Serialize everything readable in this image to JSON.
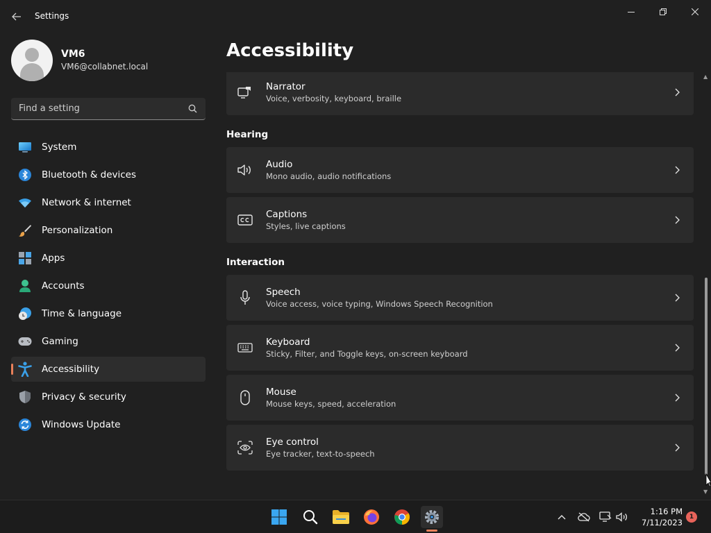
{
  "window": {
    "app_title": "Settings",
    "back_icon": "arrow-left-icon",
    "controls": [
      "minimize-icon",
      "restore-icon",
      "close-icon"
    ]
  },
  "profile": {
    "name": "VM6",
    "email": "VM6@collabnet.local"
  },
  "search": {
    "placeholder": "Find a setting",
    "value": ""
  },
  "sidebar": {
    "items": [
      {
        "label": "System",
        "icon": "monitor-icon"
      },
      {
        "label": "Bluetooth & devices",
        "icon": "bluetooth-icon"
      },
      {
        "label": "Network & internet",
        "icon": "wifi-icon"
      },
      {
        "label": "Personalization",
        "icon": "brush-icon"
      },
      {
        "label": "Apps",
        "icon": "apps-icon"
      },
      {
        "label": "Accounts",
        "icon": "person-icon"
      },
      {
        "label": "Time & language",
        "icon": "globe-clock-icon"
      },
      {
        "label": "Gaming",
        "icon": "gamepad-icon"
      },
      {
        "label": "Accessibility",
        "icon": "accessibility-icon",
        "selected": true
      },
      {
        "label": "Privacy & security",
        "icon": "shield-icon"
      },
      {
        "label": "Windows Update",
        "icon": "update-icon"
      }
    ]
  },
  "main": {
    "title": "Accessibility",
    "narrator": {
      "title": "Narrator",
      "desc": "Voice, verbosity, keyboard, braille"
    },
    "hearing": {
      "heading": "Hearing",
      "audio": {
        "title": "Audio",
        "desc": "Mono audio, audio notifications"
      },
      "captions": {
        "title": "Captions",
        "desc": "Styles, live captions"
      }
    },
    "interaction": {
      "heading": "Interaction",
      "speech": {
        "title": "Speech",
        "desc": "Voice access, voice typing, Windows Speech Recognition"
      },
      "keyboard": {
        "title": "Keyboard",
        "desc": "Sticky, Filter, and Toggle keys, on-screen keyboard"
      },
      "mouse": {
        "title": "Mouse",
        "desc": "Mouse keys, speed, acceleration"
      },
      "eye_control": {
        "title": "Eye control",
        "desc": "Eye tracker, text-to-speech"
      }
    }
  },
  "taskbar": {
    "time": "1:16 PM",
    "date": "7/11/2023",
    "notification_count": "1",
    "accent_color": "#e8805a"
  }
}
